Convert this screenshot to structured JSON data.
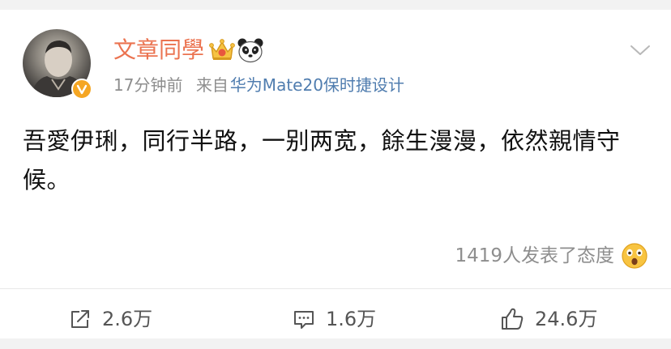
{
  "post": {
    "username": "文章同學",
    "time": "17分钟前",
    "source_prefix": "来自",
    "source_device": "华为Mate20保时捷设计",
    "content": "吾愛伊琍，同行半路，一别两宽，餘生漫漫，依然親情守候。",
    "reactions_text": "1419人发表了态度",
    "username_color": "#eb7350",
    "device_color": "#507daf",
    "verified_badge_color": "#f5a623"
  },
  "actions": {
    "repost": {
      "icon": "repost-icon",
      "count": "2.6万"
    },
    "comment": {
      "icon": "comment-icon",
      "count": "1.6万"
    },
    "like": {
      "icon": "thumbs-up-icon",
      "count": "24.6万"
    }
  },
  "badges": [
    "crown-icon",
    "panda-icon",
    "verified-v-icon"
  ]
}
